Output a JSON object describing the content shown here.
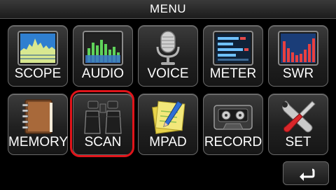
{
  "window": {
    "title": "MENU"
  },
  "menu": {
    "items": [
      {
        "label": "SCOPE",
        "icon": "spectrum-scope-icon"
      },
      {
        "label": "AUDIO",
        "icon": "audio-spectrum-icon"
      },
      {
        "label": "VOICE",
        "icon": "microphone-icon"
      },
      {
        "label": "METER",
        "icon": "meter-icon"
      },
      {
        "label": "SWR",
        "icon": "swr-graph-icon"
      },
      {
        "label": "MEMORY",
        "icon": "notebook-icon"
      },
      {
        "label": "SCAN",
        "icon": "binoculars-icon"
      },
      {
        "label": "MPAD",
        "icon": "memo-pad-icon"
      },
      {
        "label": "RECORD",
        "icon": "cassette-tape-icon"
      },
      {
        "label": "SET",
        "icon": "wrench-screwdriver-icon"
      }
    ],
    "highlighted": "SCAN",
    "highlight_color": "#e0141a"
  },
  "back_button": {
    "icon": "return-arrow-icon"
  }
}
